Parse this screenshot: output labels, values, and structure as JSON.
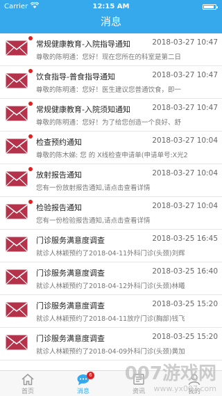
{
  "status_bar": {
    "carrier": "Carrier",
    "time": "12:15 AM"
  },
  "header": {
    "title": "消息"
  },
  "colors": {
    "primary": "#35a9eb",
    "unread_dot": "#e02020",
    "envelope": "#b5334a"
  },
  "messages": [
    {
      "title": "常规健康教育-入院指导通知",
      "date": "2018-03-27 10:47",
      "preview": "尊敬的陈明通：您好！现在您所在的科室是第二日",
      "unread": true
    },
    {
      "title": "饮食指导-普食指导通知",
      "date": "2018-03-27 10:47",
      "preview": "尊敬的陈明通：您好！医生建议您普通饮食，即一",
      "unread": true
    },
    {
      "title": "常规健康教育-入院须知通知",
      "date": "2018-03-27 10:47",
      "preview": "尊敬的陈明通：您好！为了给您创造一个良好、舒",
      "unread": true
    },
    {
      "title": "检查预约通知",
      "date": "2018-03-27 10:04",
      "preview": "尊敬的陈木娣: 您 的 X线检查申请单(申请单号:X光2",
      "unread": true
    },
    {
      "title": "放射报告通知",
      "date": "2018-03-27 10:04",
      "preview": "您有一份放射报告通知,请点击查看详情",
      "unread": true
    },
    {
      "title": "检验报告通知",
      "date": "2018-03-27 10:04",
      "preview": "您有一份检验报告通知,请点击查看详情",
      "unread": true
    },
    {
      "title": "门诊服务满意度调查",
      "date": "2018-03-25 16:45",
      "preview": "就诊人林颖预约了2018-04-11外科门诊(头颈)刘辉",
      "unread": false
    },
    {
      "title": "门诊服务满意度调查",
      "date": "2018-03-25 16:40",
      "preview": "就诊人林颖预约了2018-04-12外科门诊(头颈)林曦",
      "unread": false
    },
    {
      "title": "门诊服务满意度调查",
      "date": "2018-03-25 15:20",
      "preview": "就诊人林颖预约了2018-04-11放疗门诊(胸部)钱飞",
      "unread": false
    },
    {
      "title": "门诊服务满意度调查",
      "date": "2018-03-25 15:20",
      "preview": "就诊人林颖预约了2018-04-09外科门诊(头颈)黄加",
      "unread": false
    }
  ],
  "tabs": [
    {
      "label": "首页",
      "icon": "home-icon",
      "active": false
    },
    {
      "label": "消息",
      "icon": "chat-icon",
      "active": true,
      "badge": "6"
    },
    {
      "label": "资讯",
      "icon": "news-icon",
      "active": false
    },
    {
      "label": "我的",
      "icon": "person-icon",
      "active": false
    }
  ],
  "watermark": {
    "brand": "007游戏网",
    "url": "www.yx007.com"
  }
}
